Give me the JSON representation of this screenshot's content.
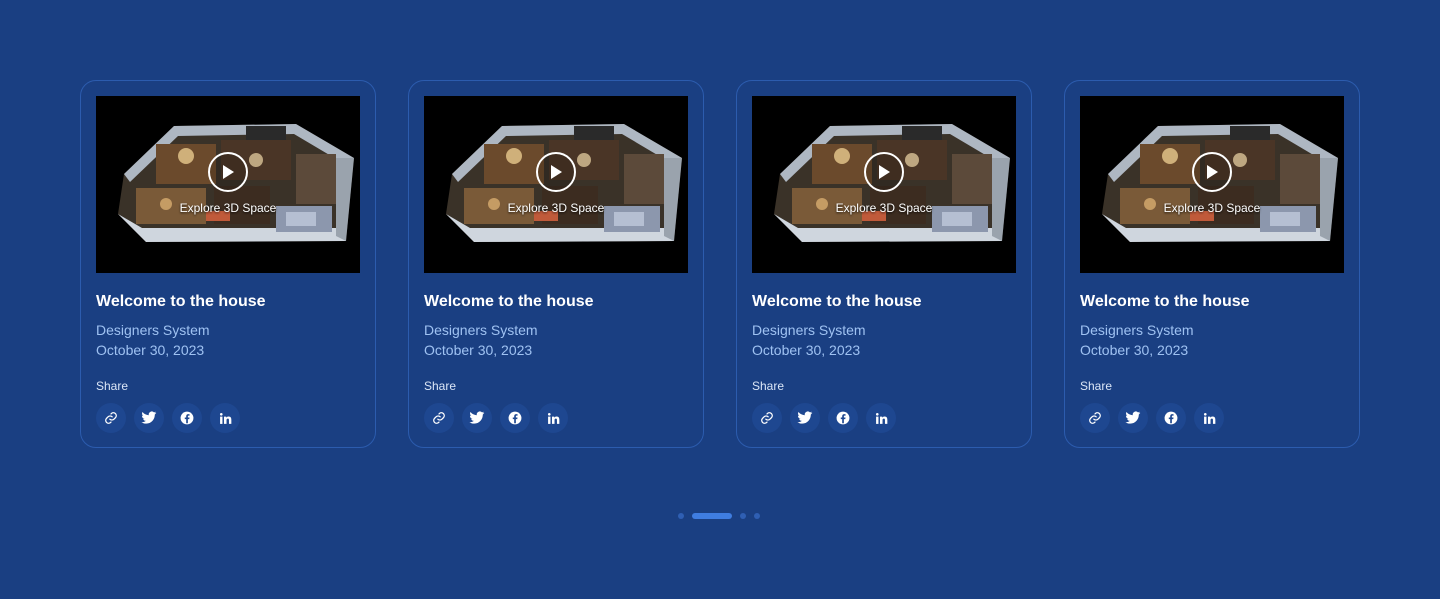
{
  "cards": [
    {
      "video_label": "Explore 3D Space",
      "title": "Welcome to the house",
      "author": "Designers System",
      "date": "October 30, 2023",
      "share_label": "Share"
    },
    {
      "video_label": "Explore 3D Space",
      "title": "Welcome to the house",
      "author": "Designers System",
      "date": "October 30, 2023",
      "share_label": "Share"
    },
    {
      "video_label": "Explore 3D Space",
      "title": "Welcome to the house",
      "author": "Designers System",
      "date": "October 30, 2023",
      "share_label": "Share"
    },
    {
      "video_label": "Explore 3D Space",
      "title": "Welcome to the house",
      "author": "Designers System",
      "date": "October 30, 2023",
      "share_label": "Share"
    }
  ],
  "share_icons": [
    "link-icon",
    "twitter-icon",
    "facebook-icon",
    "linkedin-icon"
  ],
  "pagination": {
    "count": 4,
    "active_index": 1
  },
  "colors": {
    "background": "#1a3f82",
    "card_border": "#2c5cae",
    "meta_text": "#9fc2f2",
    "active_dot": "#3f7de0"
  }
}
